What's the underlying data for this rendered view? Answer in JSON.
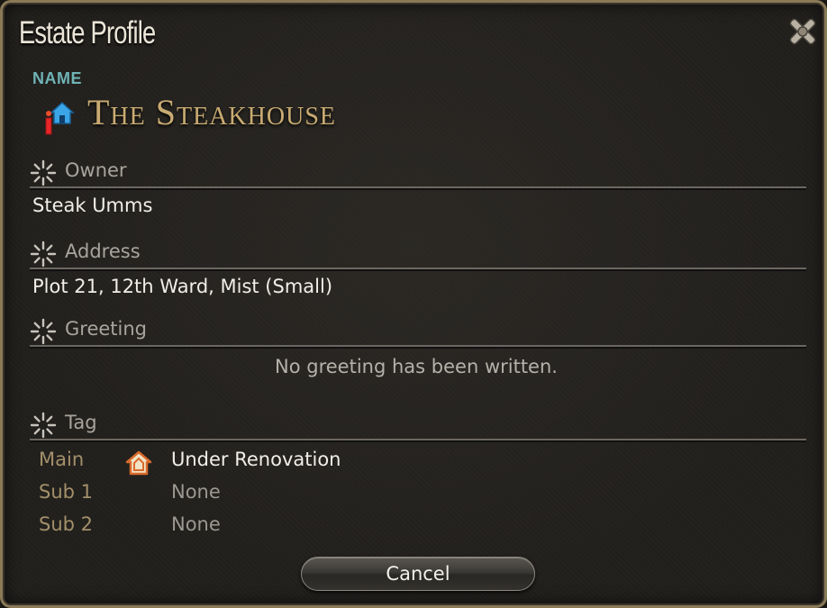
{
  "window": {
    "title": "Estate Profile",
    "close_icon": "close-x-icon"
  },
  "name": {
    "label": "NAME",
    "value": "The Steakhouse",
    "icon": "house-icon"
  },
  "sections": {
    "owner": {
      "label": "Owner",
      "value": "Steak Umms"
    },
    "address": {
      "label": "Address",
      "value": "Plot 21, 12th Ward, Mist (Small)"
    },
    "greeting": {
      "label": "Greeting",
      "value": "No greeting has been written."
    },
    "tag": {
      "label": "Tag",
      "rows": [
        {
          "key": "Main",
          "value": "Under Renovation",
          "icon": "renovation-house-icon"
        },
        {
          "key": "Sub 1",
          "value": "None"
        },
        {
          "key": "Sub 2",
          "value": "None"
        }
      ]
    }
  },
  "buttons": {
    "cancel": "Cancel"
  },
  "colors": {
    "accent_gold": "#c9ab72",
    "name_label": "#6fb3b6",
    "tag_key": "#a3906a",
    "border": "#8a7a58"
  }
}
